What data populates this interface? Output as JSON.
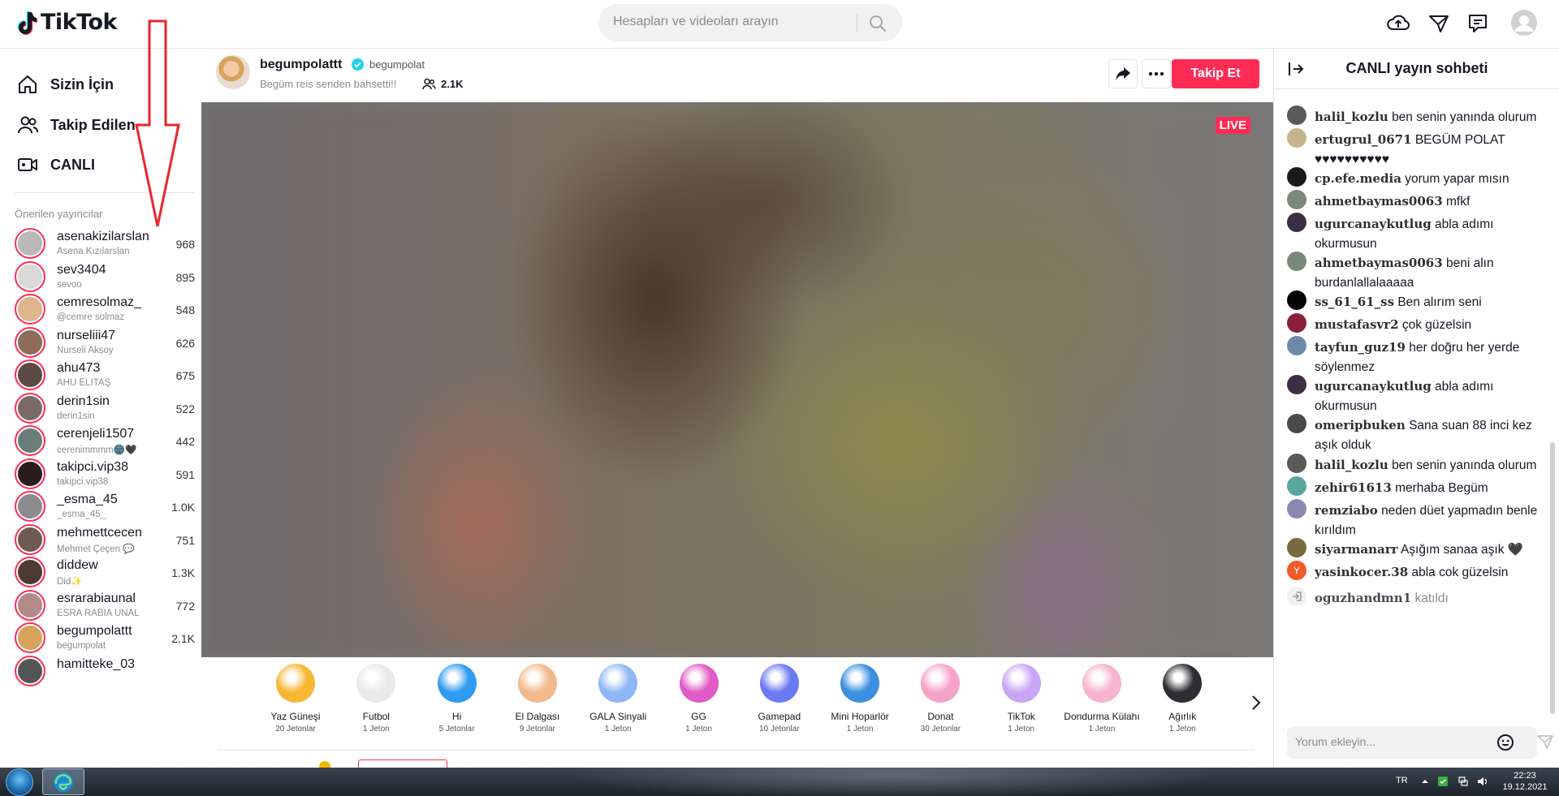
{
  "header": {
    "logo_text": "TikTok",
    "search_placeholder": "Hesapları ve videoları arayın"
  },
  "sidebar": {
    "nav": [
      {
        "label": "Sizin İçin",
        "icon": "home-icon"
      },
      {
        "label": "Takip Edilen",
        "icon": "people-icon"
      },
      {
        "label": "CANLI",
        "icon": "live-camera-icon"
      }
    ],
    "section_title": "Önerilen yayıncılar",
    "creators": [
      {
        "username": "asenakizilarslan",
        "nickname": "Asena Kızılarslan",
        "count": "968",
        "color": "#b9b9b9"
      },
      {
        "username": "sev3404",
        "nickname": "sevoo",
        "count": "895",
        "color": "#d9d9d9"
      },
      {
        "username": "cemresolmaz_",
        "nickname": "@cemre solmaz",
        "count": "548",
        "color": "#e0b48d"
      },
      {
        "username": "nurseliii47",
        "nickname": "Nurseli Aksoy",
        "count": "626",
        "color": "#8e6b5b"
      },
      {
        "username": "ahu473",
        "nickname": "AHU ELİTAŞ",
        "count": "675",
        "color": "#5c4a44"
      },
      {
        "username": "derin1sin",
        "nickname": "derin1sin",
        "count": "522",
        "color": "#7b6a66"
      },
      {
        "username": "cerenjeli1507",
        "nickname": "cerenimmmm🌚🖤",
        "count": "442",
        "color": "#6b7d78"
      },
      {
        "username": "takipci.vip38",
        "nickname": "takipci.vip38",
        "count": "591",
        "color": "#2b1b1b"
      },
      {
        "username": "_esma_45",
        "nickname": "_esma_45_",
        "count": "1.0K",
        "color": "#8d8b8f"
      },
      {
        "username": "mehmettcecen",
        "nickname": "Mehmet Çeçen 💬",
        "count": "751",
        "color": "#6e5a50"
      },
      {
        "username": "diddew",
        "nickname": "Did✨",
        "count": "1.3K",
        "color": "#4d3a32"
      },
      {
        "username": "esrarabiaunal",
        "nickname": "ESRA RABİA ÜNAL",
        "count": "772",
        "color": "#b28a86"
      },
      {
        "username": "begumpolattt",
        "nickname": "begumpolat",
        "count": "2.1K",
        "color": "#d8a35a"
      },
      {
        "username": "hamitteke_03",
        "nickname": "",
        "count": "",
        "color": "#555555"
      }
    ]
  },
  "stream": {
    "host_username": "begumpolattt",
    "host_handle": "begumpolat",
    "description": "Begüm reis senden bahsetti!!",
    "viewers": "2.1K",
    "follow_label": "Takip Et",
    "live_badge": "LIVE"
  },
  "gifts": [
    {
      "name": "Yaz Güneşi",
      "price": "20 Jetonlar",
      "color": "#f7b733"
    },
    {
      "name": "Futbol",
      "price": "1 Jeton",
      "color": "#e9e9e9"
    },
    {
      "name": "Hi",
      "price": "5 Jetonlar",
      "color": "#2e9bf0"
    },
    {
      "name": "El Dalgası",
      "price": "9 Jetonlar",
      "color": "#f2b98d"
    },
    {
      "name": "GALA Sinyali",
      "price": "1 Jeton",
      "color": "#8fb7f5"
    },
    {
      "name": "GG",
      "price": "1 Jeton",
      "color": "#e05ac8"
    },
    {
      "name": "Gamepad",
      "price": "10 Jetonlar",
      "color": "#6b79f2"
    },
    {
      "name": "Mini Hoparlör",
      "price": "1 Jeton",
      "color": "#3b8fe0"
    },
    {
      "name": "Donat",
      "price": "30 Jetonlar",
      "color": "#f5a3c7"
    },
    {
      "name": "TikTok",
      "price": "1 Jeton",
      "color": "#c9a6f5"
    },
    {
      "name": "Dondurma Külahı",
      "price": "1 Jeton",
      "color": "#f7b4d0"
    },
    {
      "name": "Ağırlık",
      "price": "1 Jeton",
      "color": "#2d2d33"
    }
  ],
  "chat": {
    "title": "CANLI yayın sohbeti",
    "input_placeholder": "Yorum ekleyin...",
    "messages": [
      {
        "user": "halil_kozlu",
        "text": "ben senin yanında olurum",
        "color": "#5a5a5a"
      },
      {
        "user": "ertugrul_0671",
        "text": "BEGÜM POLAT ♥♥♥♥♥♥♥♥♥♥",
        "color": "#c4b48e"
      },
      {
        "user": "cp.efe.media",
        "text": "yorum yapar mısın",
        "color": "#1a1a1a"
      },
      {
        "user": "ahmetbaymas0063",
        "text": "mfkf",
        "color": "#7a8a78"
      },
      {
        "user": "ugurcanaykutlug",
        "text": "abla adımı okurmusun",
        "color": "#3b3040"
      },
      {
        "user": "ahmetbaymas0063",
        "text": "beni alın burdanlallalaaaaa",
        "color": "#7a8a78"
      },
      {
        "user": "ss_61_61_ss",
        "text": "Ben alırım seni",
        "color": "#050505"
      },
      {
        "user": "mustafasvr2",
        "text": "çok güzelsin",
        "color": "#8a1f3a"
      },
      {
        "user": "tayfun_guz19",
        "text": "her doğru her yerde söylenmez",
        "color": "#6f8aa8"
      },
      {
        "user": "ugurcanaykutlug",
        "text": "abla adımı okurmusun",
        "color": "#3b3040"
      },
      {
        "user": "omeripbuken",
        "text": "Sana suan 88 inci kez aşık olduk",
        "color": "#4a4a4a"
      },
      {
        "user": "halil_kozlu",
        "text": "ben senin yanında olurum",
        "color": "#5a5a5a"
      },
      {
        "user": "zehir61613",
        "text": "merhaba Begüm",
        "color": "#5aa5a0"
      },
      {
        "user": "remziabo",
        "text": "neden düet yapmadın benle kırıldım",
        "color": "#8a8ab0"
      },
      {
        "user": "siyarmanarr",
        "text": "Aşığım sanaa aşık 🖤",
        "color": "#7a6a40"
      },
      {
        "user": "yasinkocer.38",
        "text": "abla cok güzelsin",
        "color": "#f25a2a",
        "initial": "Y"
      },
      {
        "user": "oguzhandmn1",
        "text": "katıldı",
        "join": true
      }
    ]
  },
  "taskbar": {
    "lang": "TR",
    "time": "22:23",
    "date": "19.12.2021"
  }
}
